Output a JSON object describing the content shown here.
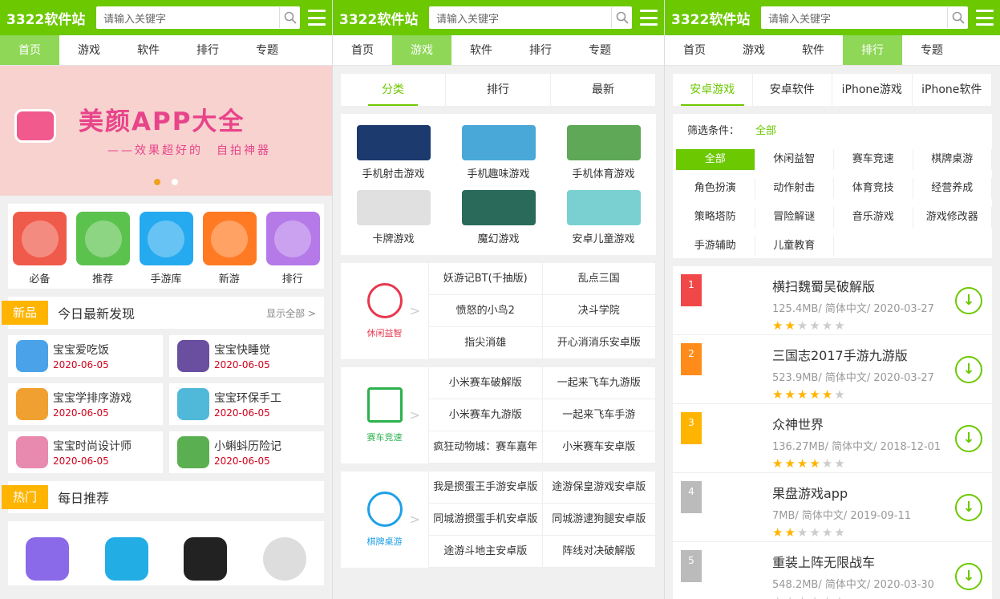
{
  "logo": "3322软件站",
  "search_placeholder": "请输入关键字",
  "nav": [
    "首页",
    "游戏",
    "软件",
    "排行",
    "专题"
  ],
  "banner": {
    "title": "美颜APP大全",
    "subtitle": "——效果超好的　自拍神器"
  },
  "categories": [
    "必备",
    "推荐",
    "手游库",
    "新游",
    "排行"
  ],
  "section_new": {
    "tag": "新品",
    "title": "今日最新发现",
    "more": "显示全部 >"
  },
  "new_games": [
    {
      "name": "宝宝爱吃饭",
      "date": "2020-06-05"
    },
    {
      "name": "宝宝快睡觉",
      "date": "2020-06-05"
    },
    {
      "name": "宝宝学排序游戏",
      "date": "2020-06-05"
    },
    {
      "name": "宝宝环保手工",
      "date": "2020-06-05"
    },
    {
      "name": "宝宝时尚设计师",
      "date": "2020-06-05"
    },
    {
      "name": "小蝌蚪历险记",
      "date": "2020-06-05"
    }
  ],
  "section_hot": {
    "tag": "热门",
    "title": "每日推荐"
  },
  "game_tabs": [
    "分类",
    "排行",
    "最新"
  ],
  "game_cats": [
    "手机射击游戏",
    "手机趣味游戏",
    "手机体育游戏",
    "卡牌游戏",
    "魔幻游戏",
    "安卓儿童游戏"
  ],
  "blocks": [
    {
      "label": "休闲益智",
      "color": "#e8384f",
      "items": [
        "妖游记BT(千抽版)",
        "乱点三国",
        "愤怒的小鸟2",
        "决斗学院",
        "指尖消雄",
        "开心消消乐安卓版"
      ]
    },
    {
      "label": "赛车竞速",
      "color": "#2bb24c",
      "items": [
        "小米赛车破解版",
        "一起来飞车九游版",
        "小米赛车九游版",
        "一起来飞车手游",
        "疯狂动物城：赛车嘉年",
        "小米赛车安卓版"
      ]
    },
    {
      "label": "棋牌桌游",
      "color": "#1ea0e8",
      "items": [
        "我是掼蛋王手游安卓版",
        "途游保皇游戏安卓版",
        "同城游掼蛋手机安卓版",
        "同城游逮狗腿安卓版",
        "途游斗地主安卓版",
        "阵线对决破解版"
      ]
    }
  ],
  "rank_tabs": [
    "安卓游戏",
    "安卓软件",
    "iPhone游戏",
    "iPhone软件"
  ],
  "filter": {
    "label": "筛选条件：",
    "value": "全部"
  },
  "tags": [
    "全部",
    "休闲益智",
    "赛车竞速",
    "棋牌桌游",
    "角色扮演",
    "动作射击",
    "体育竞技",
    "经营养成",
    "策略塔防",
    "冒险解谜",
    "音乐游戏",
    "游戏修改器",
    "手游辅助",
    "儿童教育"
  ],
  "rank": [
    {
      "n": "1",
      "name": "横扫魏蜀吴破解版",
      "meta": "125.4MB/ 简体中文/ 2020-03-27",
      "stars": 2,
      "color": "#f04848"
    },
    {
      "n": "2",
      "name": "三国志2017手游九游版",
      "meta": "523.9MB/ 简体中文/ 2020-03-27",
      "stars": 5,
      "color": "#ff8c1a"
    },
    {
      "n": "3",
      "name": "众神世界",
      "meta": "136.27MB/ 简体中文/ 2018-12-01",
      "stars": 4,
      "color": "#ffb400"
    },
    {
      "n": "4",
      "name": "果盘游戏app",
      "meta": "7MB/ 简体中文/ 2019-09-11",
      "stars": 2,
      "color": "#bbbbbb"
    },
    {
      "n": "5",
      "name": "重装上阵无限战车",
      "meta": "548.2MB/ 简体中文/ 2020-03-30",
      "stars": 0,
      "color": "#bbbbbb"
    }
  ]
}
